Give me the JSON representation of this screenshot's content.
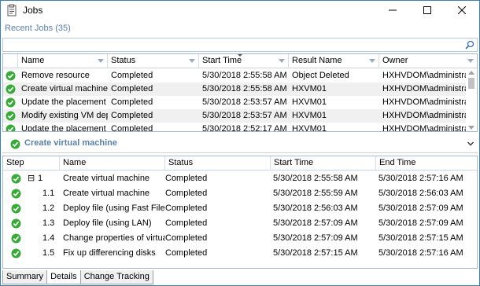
{
  "window": {
    "title": "Jobs"
  },
  "recent_jobs": {
    "header": "Recent Jobs (35)",
    "search_value": "",
    "search_placeholder": ""
  },
  "jobs_columns": [
    "Name",
    "Status",
    "Start Time",
    "Result Name",
    "Owner"
  ],
  "jobs": [
    {
      "name": "Remove resource",
      "status": "Completed",
      "start": "5/30/2018 2:55:58 AM",
      "result": "Object Deleted",
      "owner": "HXHVDOM\\administrator"
    },
    {
      "name": "Create virtual machine",
      "status": "Completed",
      "start": "5/30/2018 2:55:58 AM",
      "result": "HXVM01",
      "owner": "HXHVDOM\\administrator"
    },
    {
      "name": "Update the placement se...",
      "status": "Completed",
      "start": "5/30/2018 2:53:57 AM",
      "result": "HXVM01",
      "owner": "HXHVDOM\\administrator"
    },
    {
      "name": "Modify existing VM depl...",
      "status": "Completed",
      "start": "5/30/2018 2:53:57 AM",
      "result": "HXVM01",
      "owner": "HXHVDOM\\administrator"
    },
    {
      "name": "Update the placement se...",
      "status": "Completed",
      "start": "5/30/2018 2:52:17 AM",
      "result": "HXVM01",
      "owner": "HXHVDOM\\administrator"
    }
  ],
  "selected_job": {
    "title": "Create virtual machine"
  },
  "steps_columns": [
    "Step",
    "Name",
    "Status",
    "Start Time",
    "End Time"
  ],
  "steps": [
    {
      "step": "1",
      "expander": "⊟",
      "name": "Create virtual machine",
      "status": "Completed",
      "start": "5/30/2018 2:55:58 AM",
      "end": "5/30/2018 2:57:16 AM"
    },
    {
      "step": "1.1",
      "expander": "",
      "name": "Create virtual machine",
      "status": "Completed",
      "start": "5/30/2018 2:55:59 AM",
      "end": "5/30/2018 2:56:03 AM"
    },
    {
      "step": "1.2",
      "expander": "",
      "name": "Deploy file (using Fast File Co...",
      "status": "Completed",
      "start": "5/30/2018 2:56:03 AM",
      "end": "5/30/2018 2:57:09 AM"
    },
    {
      "step": "1.3",
      "expander": "",
      "name": "Deploy file (using LAN)",
      "status": "Completed",
      "start": "5/30/2018 2:57:09 AM",
      "end": "5/30/2018 2:57:09 AM"
    },
    {
      "step": "1.4",
      "expander": "",
      "name": "Change properties of virtual...",
      "status": "Completed",
      "start": "5/30/2018 2:57:09 AM",
      "end": "5/30/2018 2:57:15 AM"
    },
    {
      "step": "1.5",
      "expander": "",
      "name": "Fix up differencing disks",
      "status": "Completed",
      "start": "5/30/2018 2:57:15 AM",
      "end": "5/30/2018 2:57:16 AM"
    }
  ],
  "tabs": [
    "Summary",
    "Details",
    "Change Tracking"
  ],
  "active_tab": "Details",
  "colors": {
    "accent": "#5b7fa6",
    "ok_green": "#3aa93a",
    "row_alt": "#f0f0f0"
  },
  "icons": {
    "title": "clipboard-icon",
    "search": "search-icon",
    "status": "check-circle-icon"
  }
}
